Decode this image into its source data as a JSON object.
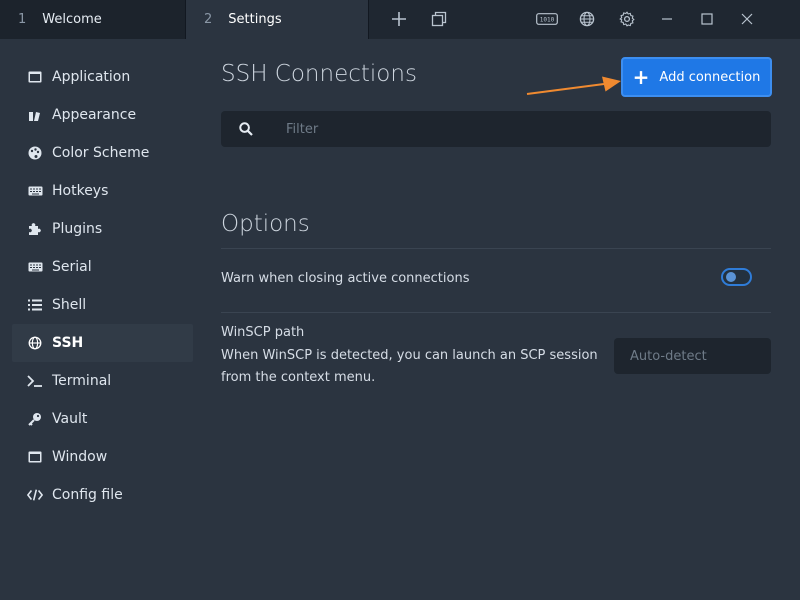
{
  "tabs": [
    {
      "number": "1",
      "label": "Welcome"
    },
    {
      "number": "2",
      "label": "Settings"
    }
  ],
  "window_controls": {
    "new_tab_icon": "plus-icon",
    "tabs_icon": "window-stack-icon",
    "serial_icon": "serial-port-icon",
    "web_icon": "globe-icon",
    "settings_icon": "gear-icon",
    "minimize_icon": "minimize-icon",
    "maximize_icon": "maximize-icon",
    "close_icon": "close-icon"
  },
  "sidebar": {
    "items": [
      {
        "label": "Application",
        "icon": "window-icon"
      },
      {
        "label": "Appearance",
        "icon": "brush-icon"
      },
      {
        "label": "Color Scheme",
        "icon": "palette-icon"
      },
      {
        "label": "Hotkeys",
        "icon": "keyboard-icon"
      },
      {
        "label": "Plugins",
        "icon": "puzzle-icon"
      },
      {
        "label": "Serial",
        "icon": "keyboard-icon"
      },
      {
        "label": "Shell",
        "icon": "list-icon"
      },
      {
        "label": "SSH",
        "icon": "globe-icon"
      },
      {
        "label": "Terminal",
        "icon": "terminal-icon"
      },
      {
        "label": "Vault",
        "icon": "key-icon"
      },
      {
        "label": "Window",
        "icon": "window-icon"
      },
      {
        "label": "Config file",
        "icon": "code-icon"
      }
    ],
    "active": "SSH"
  },
  "main": {
    "title": "SSH Connections",
    "add_button_label": "Add connection",
    "filter_placeholder": "Filter",
    "options_title": "Options",
    "warn_label": "Warn when closing active connections",
    "warn_enabled": false,
    "winscp_title": "WinSCP path",
    "winscp_description": "When WinSCP is detected, you can launch an SCP session from the context menu.",
    "winscp_placeholder": "Auto-detect"
  },
  "colors": {
    "accent": "#1f78e6",
    "annotation_arrow": "#f08a30"
  }
}
